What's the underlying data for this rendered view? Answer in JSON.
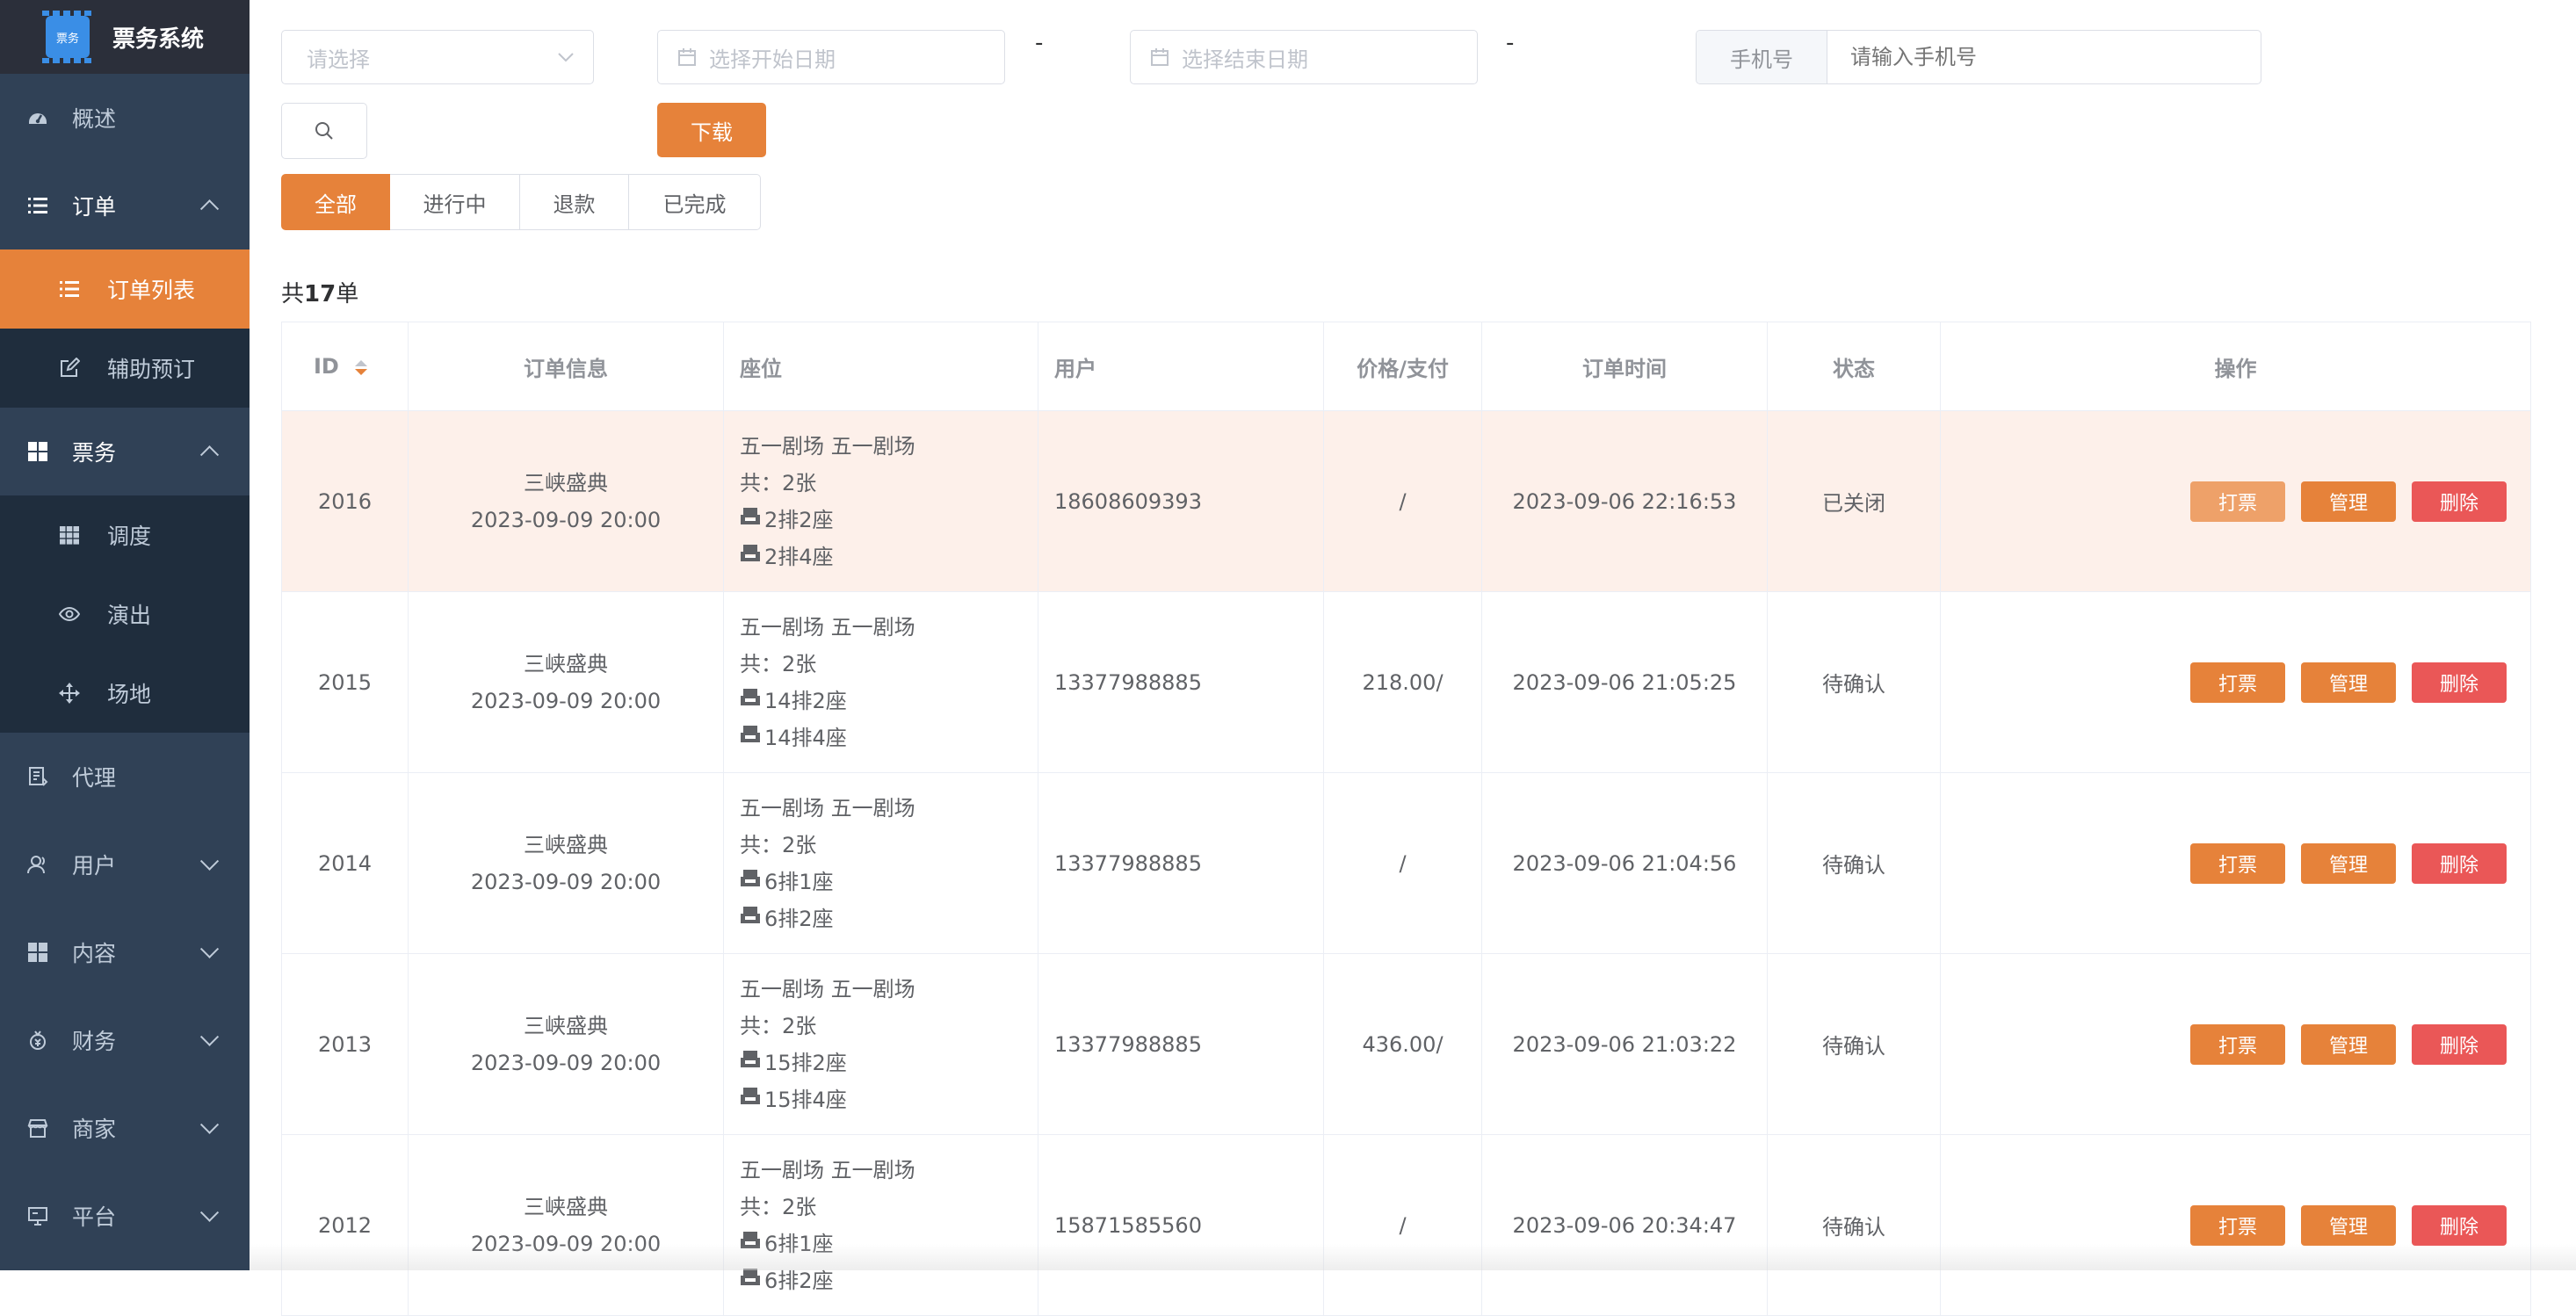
{
  "app": {
    "title": "票务系统",
    "logo_text": "票务"
  },
  "sidebar": {
    "items": [
      {
        "label": "概述",
        "icon": "dashboard-icon"
      },
      {
        "label": "订单",
        "icon": "list-icon",
        "expanded": true,
        "children": [
          {
            "label": "订单列表",
            "icon": "list-icon",
            "active": true
          },
          {
            "label": "辅助预订",
            "icon": "edit-icon"
          }
        ]
      },
      {
        "label": "票务",
        "icon": "grid-icon",
        "expanded": true,
        "children": [
          {
            "label": "调度",
            "icon": "table-icon"
          },
          {
            "label": "演出",
            "icon": "eye-icon"
          },
          {
            "label": "场地",
            "icon": "move-icon"
          }
        ]
      },
      {
        "label": "代理",
        "icon": "document-icon"
      },
      {
        "label": "用户",
        "icon": "user-icon"
      },
      {
        "label": "内容",
        "icon": "grid-icon"
      },
      {
        "label": "财务",
        "icon": "money-icon"
      },
      {
        "label": "商家",
        "icon": "shop-icon"
      },
      {
        "label": "平台",
        "icon": "monitor-icon"
      }
    ]
  },
  "filters": {
    "select_placeholder": "请选择",
    "start_date_placeholder": "选择开始日期",
    "end_date_placeholder": "选择结束日期",
    "separator": "-",
    "phone_label": "手机号",
    "phone_placeholder": "请输入手机号",
    "download_label": "下载"
  },
  "tabs": [
    {
      "label": "全部",
      "active": true
    },
    {
      "label": "进行中"
    },
    {
      "label": "退款"
    },
    {
      "label": "已完成"
    }
  ],
  "summary": {
    "prefix": "共",
    "count": "17",
    "suffix": "单"
  },
  "table": {
    "columns": [
      "ID",
      "订单信息",
      "座位",
      "用户",
      "价格/支付",
      "订单时间",
      "状态",
      "操作"
    ],
    "rows": [
      {
        "id": "2016",
        "show": "三峡盛典",
        "show_time": "2023-09-09 20:00",
        "venue": "五一剧场 五一剧场",
        "count": "共：2张",
        "seats": [
          "2排2座",
          "2排4座"
        ],
        "user": "18608609393",
        "price": "/",
        "time": "2023-09-06 22:16:53",
        "status": "已关闭"
      },
      {
        "id": "2015",
        "show": "三峡盛典",
        "show_time": "2023-09-09 20:00",
        "venue": "五一剧场 五一剧场",
        "count": "共：2张",
        "seats": [
          "14排2座",
          "14排4座"
        ],
        "user": "13377988885",
        "price": "218.00/",
        "time": "2023-09-06 21:05:25",
        "status": "待确认"
      },
      {
        "id": "2014",
        "show": "三峡盛典",
        "show_time": "2023-09-09 20:00",
        "venue": "五一剧场 五一剧场",
        "count": "共：2张",
        "seats": [
          "6排1座",
          "6排2座"
        ],
        "user": "13377988885",
        "price": "/",
        "time": "2023-09-06 21:04:56",
        "status": "待确认"
      },
      {
        "id": "2013",
        "show": "三峡盛典",
        "show_time": "2023-09-09 20:00",
        "venue": "五一剧场 五一剧场",
        "count": "共：2张",
        "seats": [
          "15排2座",
          "15排4座"
        ],
        "user": "13377988885",
        "price": "436.00/",
        "time": "2023-09-06 21:03:22",
        "status": "待确认"
      },
      {
        "id": "2012",
        "show": "三峡盛典",
        "show_time": "2023-09-09 20:00",
        "venue": "五一剧场 五一剧场",
        "count": "共：2张",
        "seats": [
          "6排1座",
          "6排2座"
        ],
        "user": "15871585560",
        "price": "/",
        "time": "2023-09-06 20:34:47",
        "status": "待确认"
      }
    ],
    "actions": {
      "print": "打票",
      "manage": "管理",
      "delete": "删除"
    }
  },
  "colors": {
    "accent": "#e6823a",
    "danger": "#ea5757",
    "sidebar_bg": "#304156",
    "sidebar_sub_bg": "#1f2d3d"
  }
}
